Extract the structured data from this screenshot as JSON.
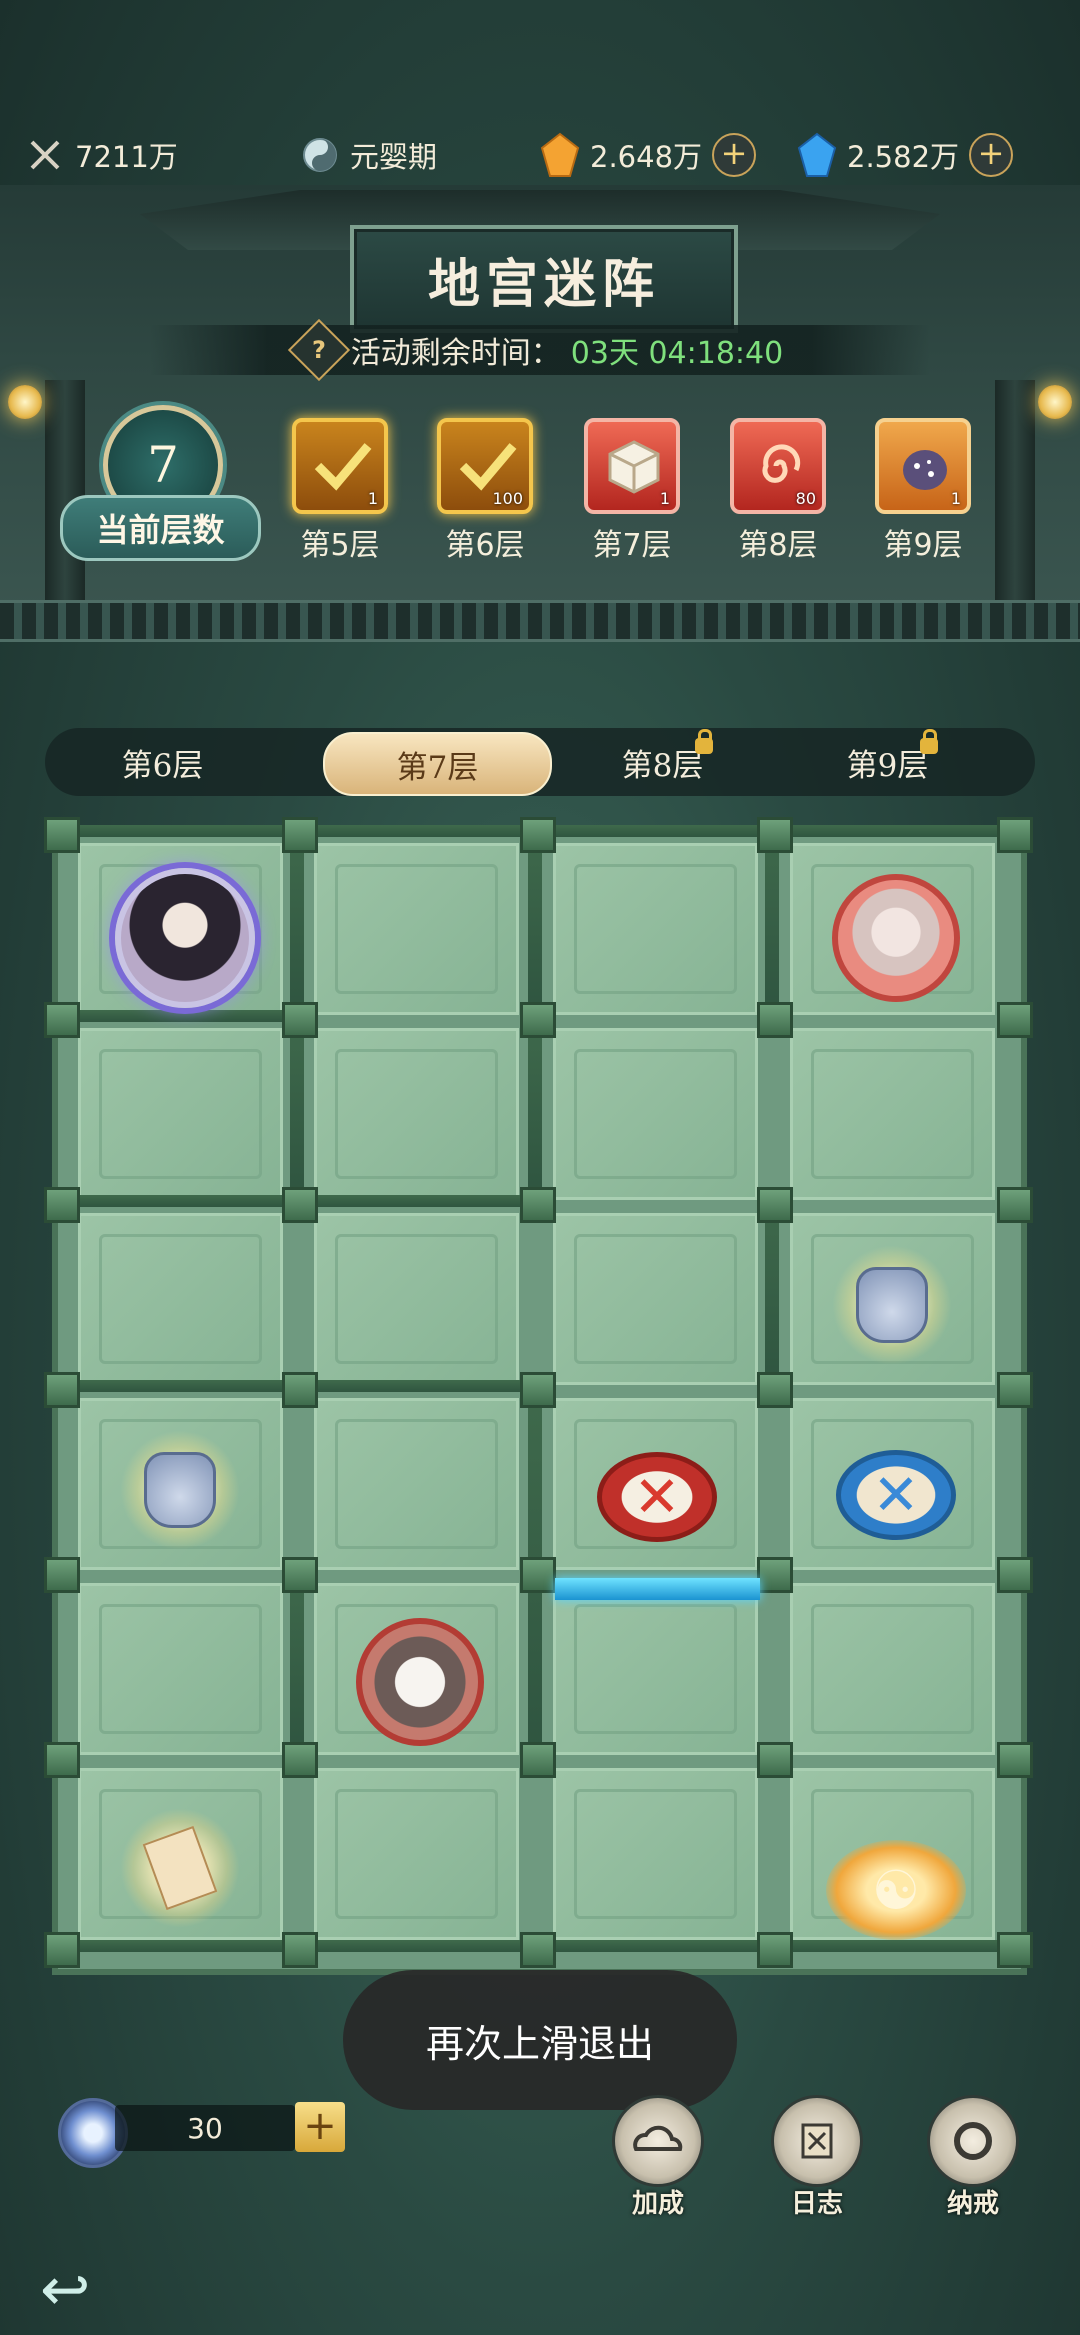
{
  "resources": {
    "power": "7211万",
    "realm": "元婴期",
    "gold_crystal": "2.648万",
    "blue_crystal": "2.582万",
    "plus": "+"
  },
  "header": {
    "title": "地宫迷阵",
    "timer_label": "活动剩余时间：",
    "timer_value": "03天 04:18:40",
    "help": "?"
  },
  "current_layer": {
    "value": "7",
    "label": "当前层数"
  },
  "rewards": [
    {
      "label": "第5层",
      "count": "1",
      "claimed": true
    },
    {
      "label": "第6层",
      "count": "100",
      "claimed": true
    },
    {
      "label": "第7层",
      "count": "1",
      "claimed": false
    },
    {
      "label": "第8层",
      "count": "80",
      "claimed": false
    },
    {
      "label": "第9层",
      "count": "1",
      "claimed": false
    }
  ],
  "tabs": [
    {
      "label": "第6层",
      "active": false,
      "locked": false
    },
    {
      "label": "第7层",
      "active": true,
      "locked": false
    },
    {
      "label": "第8层",
      "active": false,
      "locked": true
    },
    {
      "label": "第9层",
      "active": false,
      "locked": true
    }
  ],
  "board": {
    "red_x": "✕",
    "blue_x": "✕",
    "taiji": "☯"
  },
  "toast": "再次上滑退出",
  "bottom": {
    "stamina": "30",
    "stamina_plus": "+",
    "buttons": [
      {
        "label": "加成",
        "icon": "cloud-icon"
      },
      {
        "label": "日志",
        "icon": "scroll-icon"
      },
      {
        "label": "纳戒",
        "icon": "ring-icon"
      }
    ],
    "back_icon": "↩"
  },
  "colors": {
    "timer": "#7fe07d",
    "accent_gold": "#f4c64c",
    "tab_active": "#d9b47a"
  }
}
